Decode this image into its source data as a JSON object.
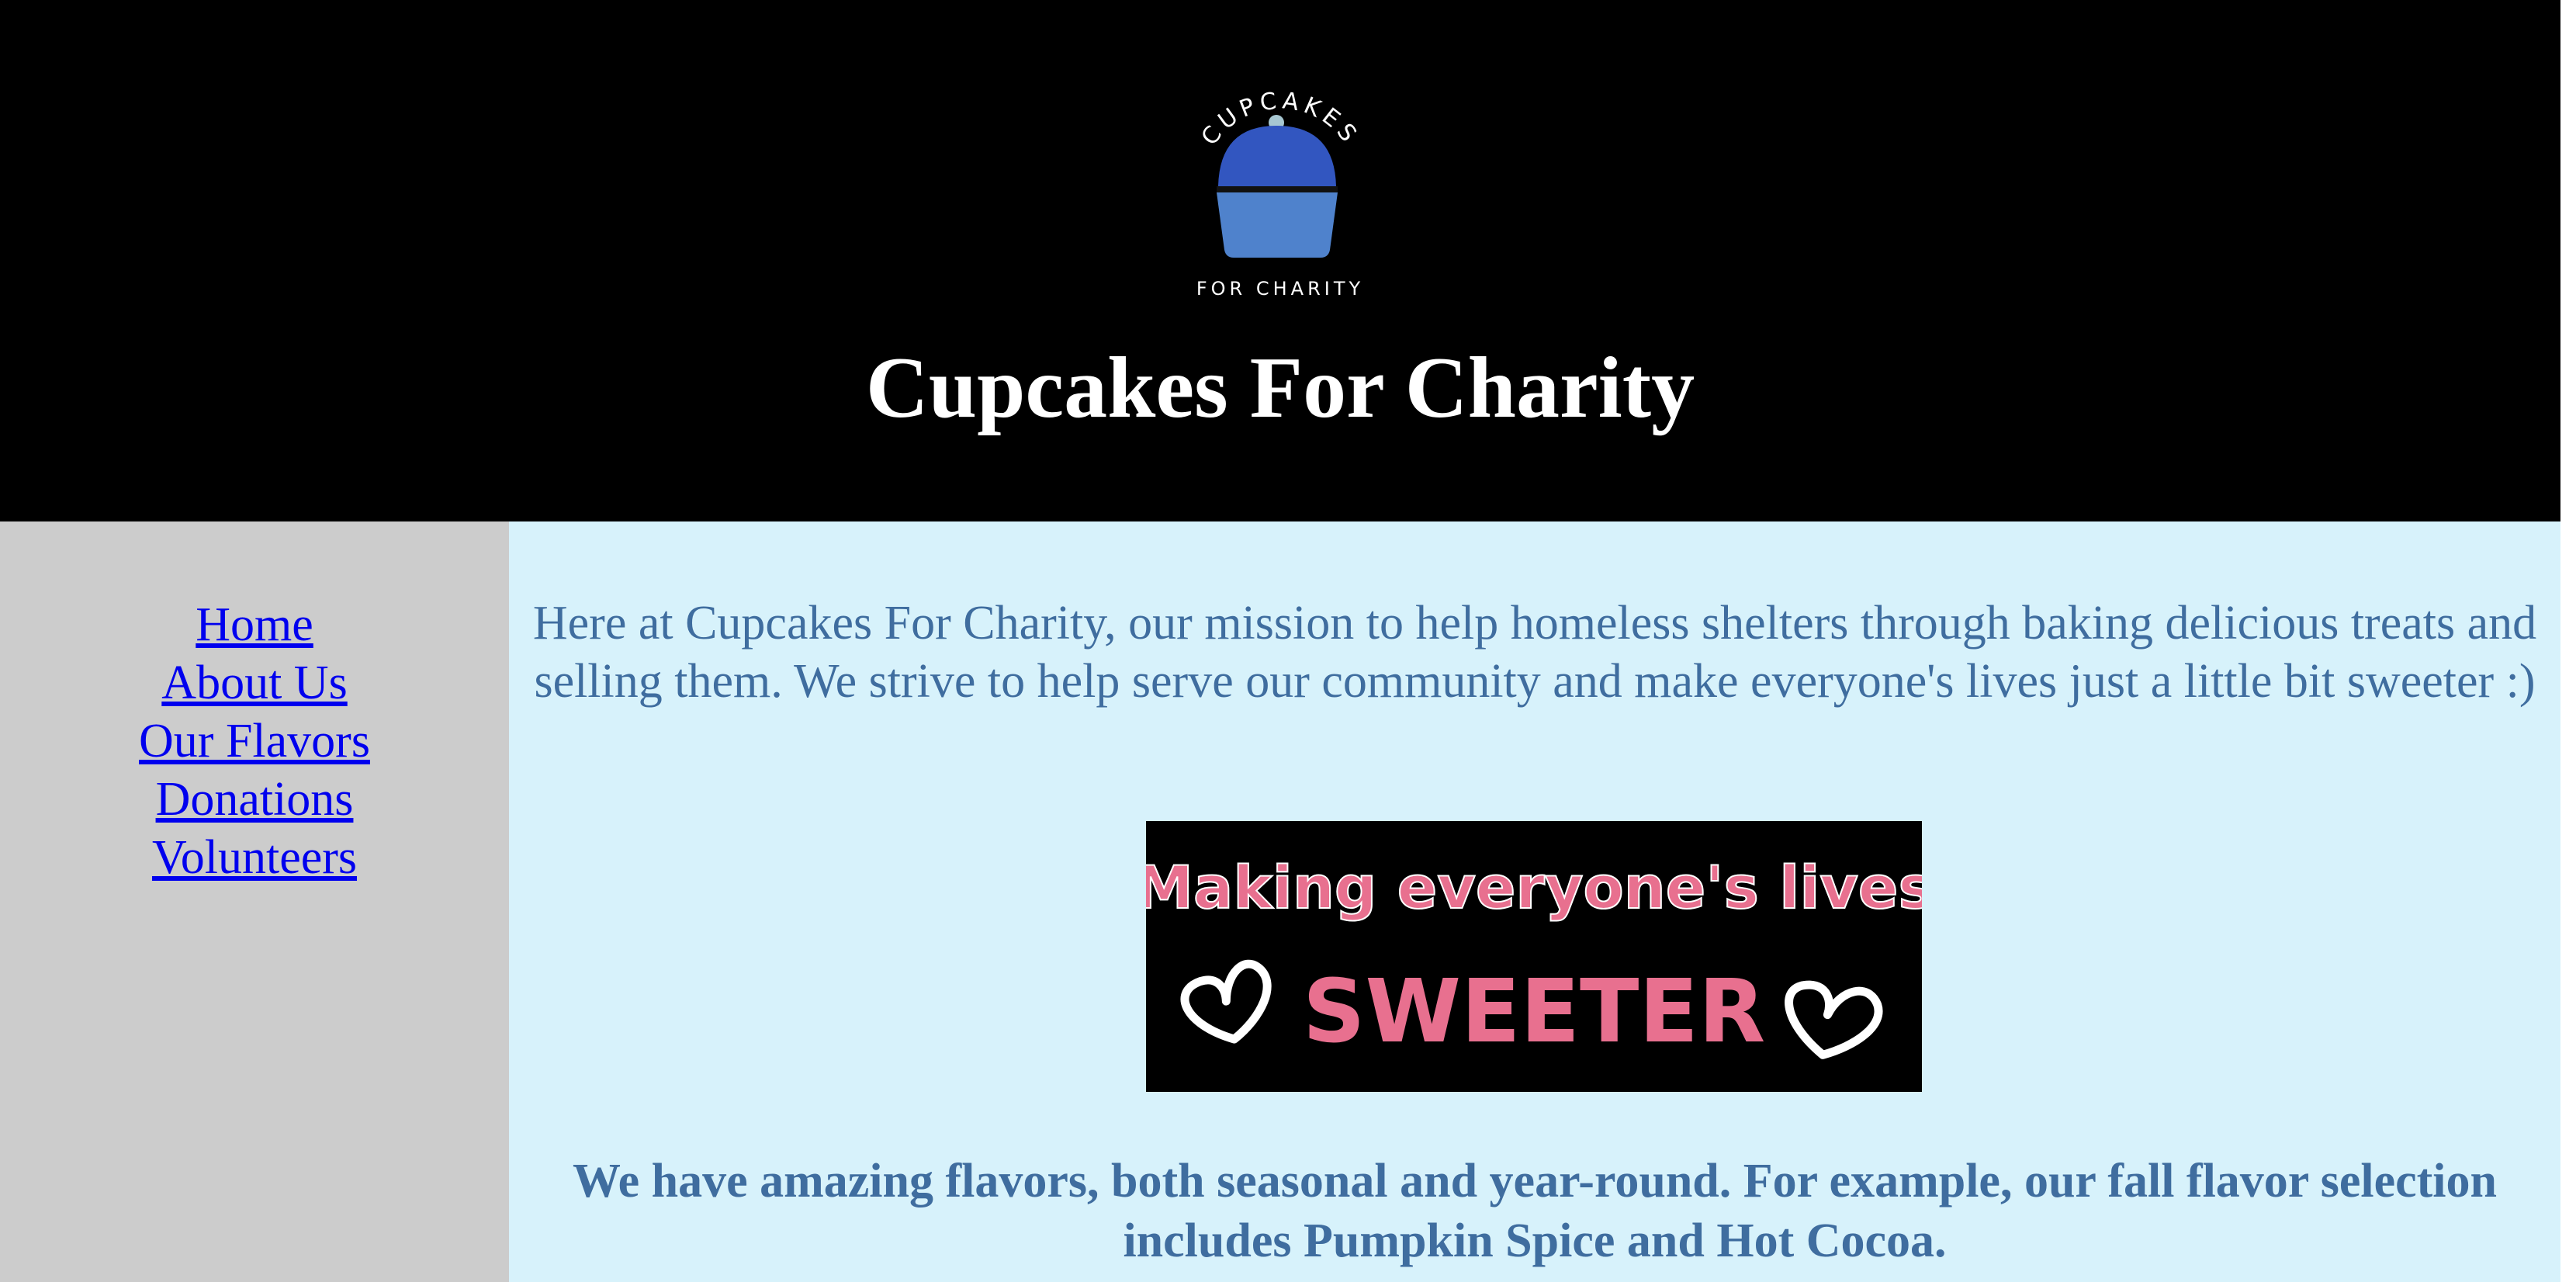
{
  "header": {
    "logo": {
      "arc_text": "CUPCAKES",
      "caption": "FOR CHARITY",
      "frosting_color": "#3256c0",
      "wrapper_color": "#4f82cc"
    },
    "title": "Cupcakes For Charity"
  },
  "sidebar": {
    "nav": [
      {
        "label": "Home"
      },
      {
        "label": "About Us"
      },
      {
        "label": "Our Flavors"
      },
      {
        "label": "Donations"
      },
      {
        "label": "Volunteers"
      }
    ]
  },
  "main": {
    "intro": "Here at Cupcakes For Charity, our mission to help homeless shelters through baking delicious treats and selling them. We strive to help serve our community and make everyone's lives just a little bit sweeter :)",
    "banner": {
      "line1": "Making everyone's lives",
      "line2": "SWEETER",
      "text_color": "#e8708f"
    },
    "flavors_text": "We have amazing flavors, both seasonal and year-round. For example, our fall flavor selection includes Pumpkin Spice and Hot Cocoa."
  },
  "colors": {
    "header_bg": "#000000",
    "sidebar_bg": "#cccccc",
    "main_bg": "#d7f2fb",
    "body_text": "#3f6d9f",
    "link": "#0000ee"
  }
}
